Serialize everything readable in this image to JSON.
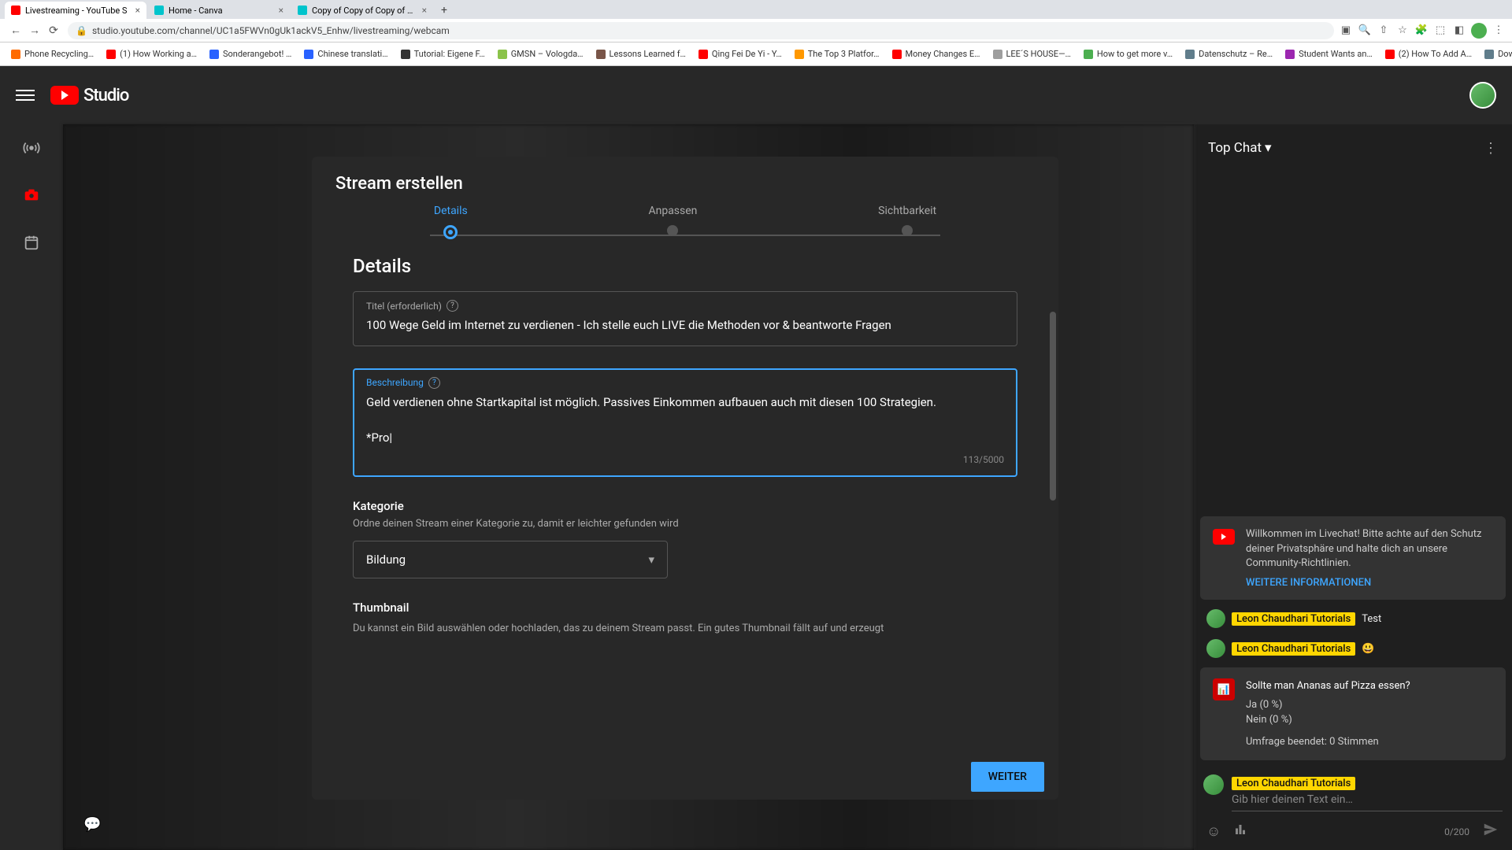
{
  "browser": {
    "tabs": [
      {
        "title": "Livestreaming - YouTube S",
        "favicon": "#ff0000",
        "active": true
      },
      {
        "title": "Home - Canva",
        "favicon": "#00c4cc",
        "active": false
      },
      {
        "title": "Copy of Copy of Copy of Copy",
        "favicon": "#00c4cc",
        "active": false
      }
    ],
    "url": "studio.youtube.com/channel/UC1a5FWVn0gUk1ackV5_Enhw/livestreaming/webcam",
    "bookmarks": [
      {
        "label": "Phone Recycling…",
        "color": "#ff6b00"
      },
      {
        "label": "(1) How Working a…",
        "color": "#ff0000"
      },
      {
        "label": "Sonderangebot! …",
        "color": "#2962ff"
      },
      {
        "label": "Chinese translati…",
        "color": "#2962ff"
      },
      {
        "label": "Tutorial: Eigene F…",
        "color": "#333"
      },
      {
        "label": "GMSN – Vologda…",
        "color": "#8bc34a"
      },
      {
        "label": "Lessons Learned f…",
        "color": "#795548"
      },
      {
        "label": "Qing Fei De Yi - Y…",
        "color": "#ff0000"
      },
      {
        "label": "The Top 3 Platfor…",
        "color": "#ff9800"
      },
      {
        "label": "Money Changes E…",
        "color": "#ff0000"
      },
      {
        "label": "LEE´S HOUSE—…",
        "color": "#9e9e9e"
      },
      {
        "label": "How to get more v…",
        "color": "#4caf50"
      },
      {
        "label": "Datenschutz – Re…",
        "color": "#607d8b"
      },
      {
        "label": "Student Wants an…",
        "color": "#9c27b0"
      },
      {
        "label": "(2) How To Add A…",
        "color": "#ff0000"
      },
      {
        "label": "Download - Cooki…",
        "color": "#607d8b"
      }
    ]
  },
  "header": {
    "studio": "Studio"
  },
  "modal": {
    "title": "Stream erstellen",
    "steps": [
      "Details",
      "Anpassen",
      "Sichtbarkeit"
    ],
    "section_heading": "Details",
    "title_field": {
      "label": "Titel (erforderlich)",
      "value": "100 Wege Geld im Internet zu verdienen - Ich stelle euch LIVE die Methoden vor & beantworte Fragen"
    },
    "desc_field": {
      "label": "Beschreibung",
      "value": "Geld verdienen ohne Startkapital ist möglich. Passives Einkommen aufbauen auch mit diesen 100 Strategien.\n\n*Pro",
      "counter": "113/5000"
    },
    "category": {
      "label": "Kategorie",
      "hint": "Ordne deinen Stream einer Kategorie zu, damit er leichter gefunden wird",
      "value": "Bildung"
    },
    "thumbnail": {
      "label": "Thumbnail",
      "hint": "Du kannst ein Bild auswählen oder hochladen, das zu deinem Stream passt. Ein gutes Thumbnail fällt auf und erzeugt"
    },
    "next": "WEITER"
  },
  "chat": {
    "header": "Top Chat",
    "welcome": "Willkommen im Livechat! Bitte achte auf den Schutz deiner Privatsphäre und halte dich an unsere Community-Richtlinien.",
    "welcome_link": "WEITERE INFORMATIONEN",
    "author": "Leon Chaudhari Tutorials",
    "msg_test": "Test",
    "emoji": "😃",
    "poll": {
      "question": "Sollte man Ananas auf Pizza essen?",
      "opt1": "Ja (0 %)",
      "opt2": "Nein (0 %)",
      "ended": "Umfrage beendet: 0 Stimmen"
    },
    "input_placeholder": "Gib hier deinen Text ein…",
    "input_counter": "0/200"
  }
}
